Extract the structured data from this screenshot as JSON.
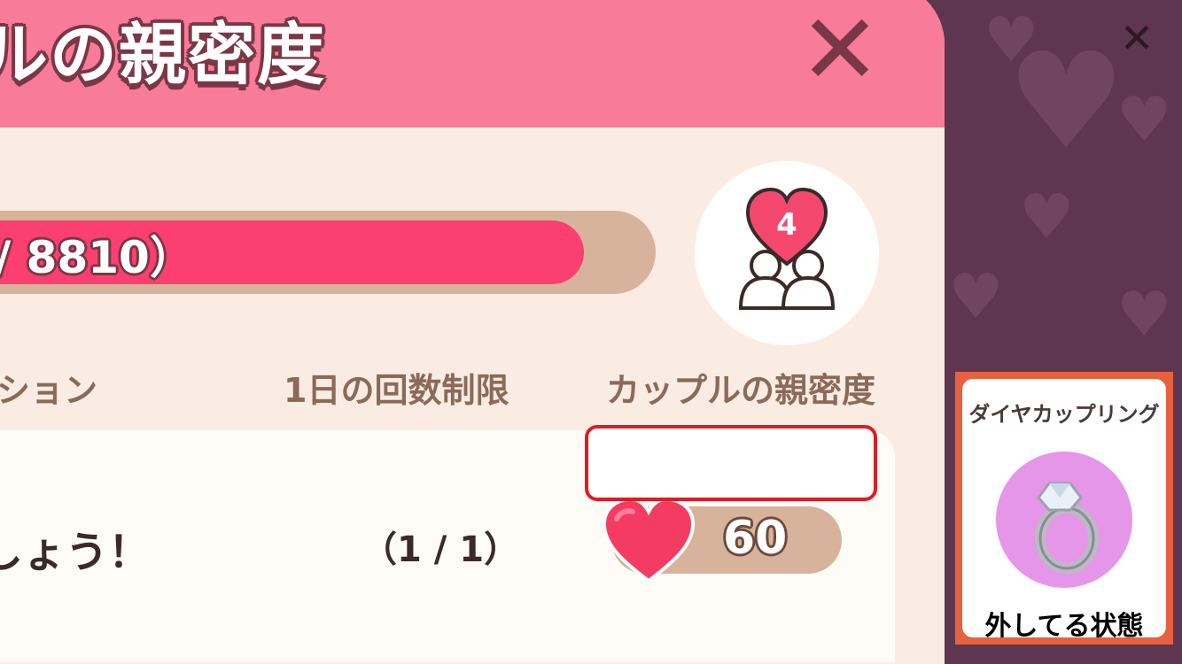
{
  "panel": {
    "title": "ルの親密度",
    "progress_text": "/ 8810）",
    "progress_fraction": 0.89,
    "level": "4"
  },
  "table": {
    "headers": {
      "mission": "ション",
      "daily_limit": "1日の回数制限",
      "intimacy": "カップルの親密度"
    },
    "rows": [
      {
        "mission": "しょう！",
        "limit": "（1 / 1）",
        "reward": "60"
      }
    ]
  },
  "item_card": {
    "name": "ダイヤカップリング",
    "status": "外してる状態"
  },
  "icons": {
    "panel_close": "close-icon",
    "outer_close": "close-icon",
    "badge": "couple-heart-icon",
    "reward": "heart-icon",
    "item": "diamond-ring-icon"
  },
  "colors": {
    "header_pink": "#f87b99",
    "progress_fill": "#fb3f71",
    "panel_bg": "#fbece3",
    "highlight": "#e11b23",
    "card_border": "#e5613f",
    "ring_bg": "#e596e8"
  }
}
